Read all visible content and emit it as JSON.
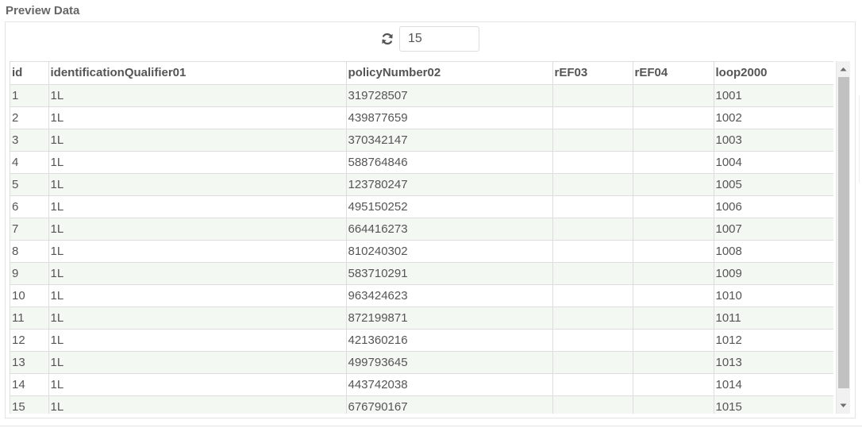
{
  "panel": {
    "title": "Preview Data"
  },
  "toolbar": {
    "refresh_icon": "refresh-icon",
    "limit_value": "15"
  },
  "table": {
    "columns": [
      "id",
      "identificationQualifier01",
      "policyNumber02",
      "rEF03",
      "rEF04",
      "loop2000"
    ],
    "rows": [
      [
        "1",
        "1L",
        "319728507",
        "",
        "",
        "1001"
      ],
      [
        "2",
        "1L",
        "439877659",
        "",
        "",
        "1002"
      ],
      [
        "3",
        "1L",
        "370342147",
        "",
        "",
        "1003"
      ],
      [
        "4",
        "1L",
        "588764846",
        "",
        "",
        "1004"
      ],
      [
        "5",
        "1L",
        "123780247",
        "",
        "",
        "1005"
      ],
      [
        "6",
        "1L",
        "495150252",
        "",
        "",
        "1006"
      ],
      [
        "7",
        "1L",
        "664416273",
        "",
        "",
        "1007"
      ],
      [
        "8",
        "1L",
        "810240302",
        "",
        "",
        "1008"
      ],
      [
        "9",
        "1L",
        "583710291",
        "",
        "",
        "1009"
      ],
      [
        "10",
        "1L",
        "963424623",
        "",
        "",
        "1010"
      ],
      [
        "11",
        "1L",
        "872199871",
        "",
        "",
        "1011"
      ],
      [
        "12",
        "1L",
        "421360216",
        "",
        "",
        "1012"
      ],
      [
        "13",
        "1L",
        "499793645",
        "",
        "",
        "1013"
      ],
      [
        "14",
        "1L",
        "443742038",
        "",
        "",
        "1014"
      ],
      [
        "15",
        "1L",
        "676790167",
        "",
        "",
        "1015"
      ]
    ]
  },
  "colors": {
    "row_alt": "#f3f8f3",
    "border": "#dddddd",
    "scroll_thumb": "#c1c1c1"
  }
}
